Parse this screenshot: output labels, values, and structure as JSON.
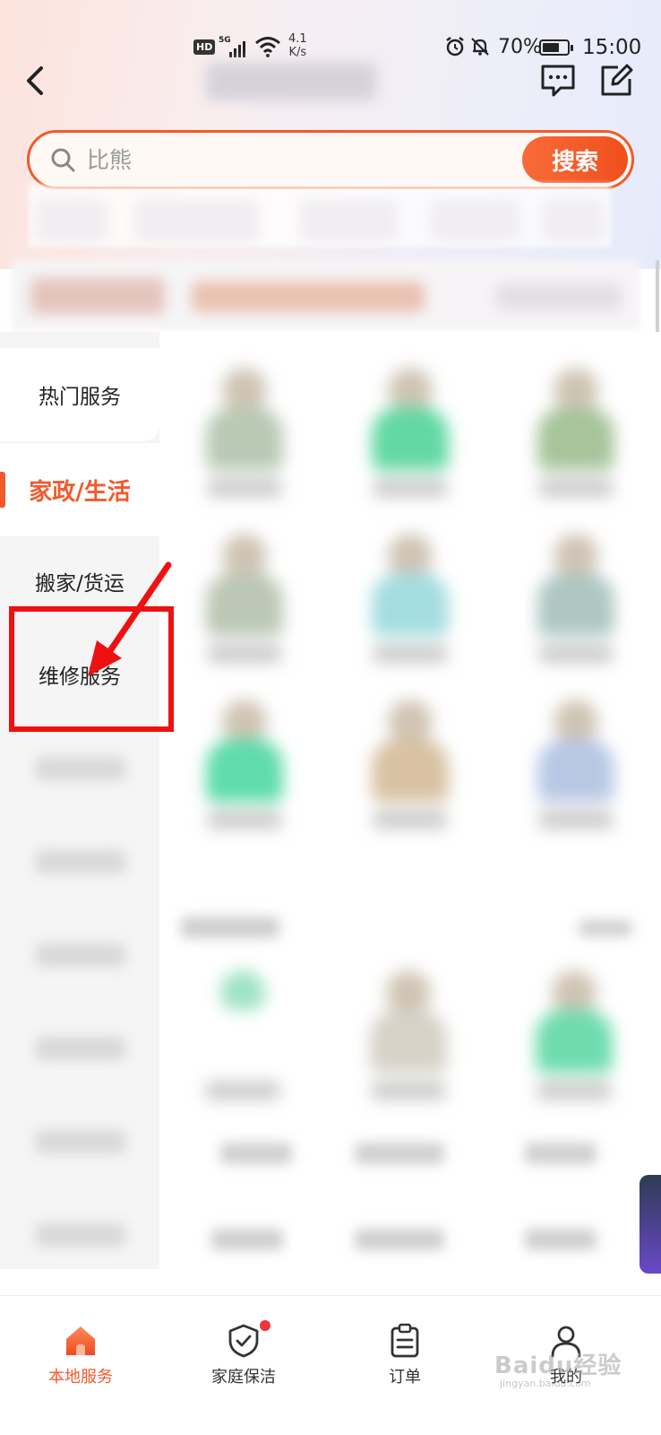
{
  "status_bar": {
    "hd": "HD",
    "network": "5G",
    "speed_value": "4.1",
    "speed_unit": "K/s",
    "battery_percent": "70%",
    "battery_level": 0.7,
    "time": "15:00"
  },
  "search": {
    "placeholder": "比熊",
    "button_label": "搜索"
  },
  "sidebar": {
    "items": [
      {
        "label": "热门服务"
      },
      {
        "label": "家政/生活"
      },
      {
        "label": "搬家/货运"
      },
      {
        "label": "维修服务"
      }
    ],
    "active_index": 1
  },
  "bottom_nav": {
    "tabs": [
      {
        "label": "本地服务",
        "icon": "home-icon"
      },
      {
        "label": "家庭保洁",
        "icon": "shield-check-icon"
      },
      {
        "label": "订单",
        "icon": "clipboard-icon"
      },
      {
        "label": "我的",
        "icon": "user-icon"
      }
    ]
  },
  "watermark": {
    "text": "Baidu经验",
    "sub": "jingyan.baidu.com"
  },
  "colors": {
    "accent": "#f15a2c",
    "annotation": "#ee1111"
  }
}
